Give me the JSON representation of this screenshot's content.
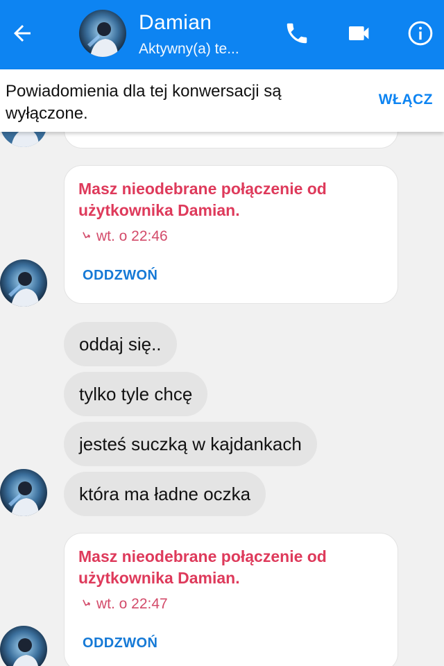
{
  "header": {
    "name": "Damian",
    "status": "Aktywny(a) te...",
    "bg_color": "#0d84f2"
  },
  "banner": {
    "text": "Powiadomienia dla tej konwersacji są wyłączone.",
    "action": "WŁĄCZ"
  },
  "messages": [
    {
      "type": "missed_call",
      "title": "Masz nieodebrane połączenie od użytkownika Damian.",
      "time": "wt. o 22:46",
      "action": "ODDZWOŃ"
    },
    {
      "type": "text",
      "text": "oddaj się.."
    },
    {
      "type": "text",
      "text": "tylko tyle chcę"
    },
    {
      "type": "text",
      "text": "jesteś suczką w kajdankach"
    },
    {
      "type": "text",
      "text": "która ma ładne oczka"
    },
    {
      "type": "missed_call",
      "title": "Masz nieodebrane połączenie od użytkownika Damian.",
      "time": "wt. o 22:47",
      "action": "ODDZWOŃ"
    }
  ],
  "colors": {
    "accent": "#0d84f2",
    "missed_call": "#de3a5b",
    "bubble": "#e4e4e4",
    "chat_bg": "#f1f1f1"
  },
  "icons": [
    "back-arrow-icon",
    "phone-icon",
    "video-camera-icon",
    "info-icon",
    "missed-call-icon"
  ]
}
